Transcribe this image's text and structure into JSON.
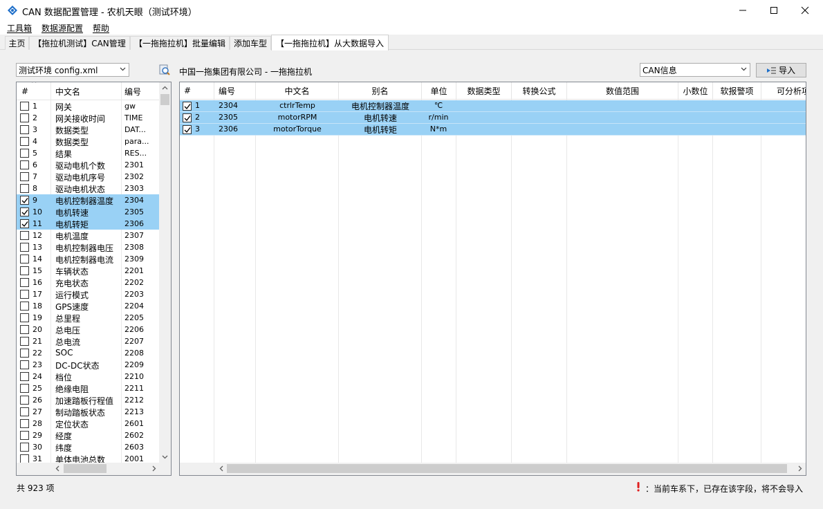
{
  "window": {
    "title": "CAN 数据配置管理 - 农机天眼（测试环境）",
    "minimize_label": "—",
    "maximize_label": "☐",
    "close_label": "✕"
  },
  "menu": [
    "工具箱",
    "数据源配置",
    "帮助"
  ],
  "tabs": [
    {
      "label": "主页",
      "active": false
    },
    {
      "label": "【拖拉机测试】CAN管理",
      "active": false
    },
    {
      "label": "【一拖拖拉机】批量编辑",
      "active": false
    },
    {
      "label": "添加车型",
      "active": false
    },
    {
      "label": "【一拖拖拉机】从大数据导入",
      "active": true
    }
  ],
  "env_select": {
    "value": "测试环境 config.xml"
  },
  "company_label": "中国一拖集团有限公司 - 一拖拖拉机",
  "can_select": {
    "value": "CAN信息"
  },
  "import_button": {
    "label": "导入"
  },
  "left_grid": {
    "headers": [
      "#",
      "中文名",
      "编号"
    ],
    "rows": [
      {
        "num": "1",
        "name": "网关",
        "code": "gw",
        "checked": false
      },
      {
        "num": "2",
        "name": "网关接收时间",
        "code": "TIME",
        "checked": false
      },
      {
        "num": "3",
        "name": "数据类型",
        "code": "DAT...",
        "checked": false
      },
      {
        "num": "4",
        "name": "数据类型",
        "code": "para...",
        "checked": false
      },
      {
        "num": "5",
        "name": "结果",
        "code": "RES...",
        "checked": false
      },
      {
        "num": "6",
        "name": "驱动电机个数",
        "code": "2301",
        "checked": false
      },
      {
        "num": "7",
        "name": "驱动电机序号",
        "code": "2302",
        "checked": false
      },
      {
        "num": "8",
        "name": "驱动电机状态",
        "code": "2303",
        "checked": false
      },
      {
        "num": "9",
        "name": "电机控制器温度",
        "code": "2304",
        "checked": true
      },
      {
        "num": "10",
        "name": "电机转速",
        "code": "2305",
        "checked": true
      },
      {
        "num": "11",
        "name": "电机转矩",
        "code": "2306",
        "checked": true
      },
      {
        "num": "12",
        "name": "电机温度",
        "code": "2307",
        "checked": false
      },
      {
        "num": "13",
        "name": "电机控制器电压",
        "code": "2308",
        "checked": false
      },
      {
        "num": "14",
        "name": "电机控制器电流",
        "code": "2309",
        "checked": false
      },
      {
        "num": "15",
        "name": "车辆状态",
        "code": "2201",
        "checked": false
      },
      {
        "num": "16",
        "name": "充电状态",
        "code": "2202",
        "checked": false
      },
      {
        "num": "17",
        "name": "运行模式",
        "code": "2203",
        "checked": false
      },
      {
        "num": "18",
        "name": "GPS速度",
        "code": "2204",
        "checked": false
      },
      {
        "num": "19",
        "name": "总里程",
        "code": "2205",
        "checked": false
      },
      {
        "num": "20",
        "name": "总电压",
        "code": "2206",
        "checked": false
      },
      {
        "num": "21",
        "name": "总电流",
        "code": "2207",
        "checked": false
      },
      {
        "num": "22",
        "name": "SOC",
        "code": "2208",
        "checked": false
      },
      {
        "num": "23",
        "name": "DC-DC状态",
        "code": "2209",
        "checked": false
      },
      {
        "num": "24",
        "name": "档位",
        "code": "2210",
        "checked": false
      },
      {
        "num": "25",
        "name": "绝缘电阻",
        "code": "2211",
        "checked": false
      },
      {
        "num": "26",
        "name": "加速踏板行程值",
        "code": "2212",
        "checked": false
      },
      {
        "num": "27",
        "name": "制动踏板状态",
        "code": "2213",
        "checked": false
      },
      {
        "num": "28",
        "name": "定位状态",
        "code": "2601",
        "checked": false
      },
      {
        "num": "29",
        "name": "经度",
        "code": "2602",
        "checked": false
      },
      {
        "num": "30",
        "name": "纬度",
        "code": "2603",
        "checked": false
      },
      {
        "num": "31",
        "name": "单体电池总数",
        "code": "2001",
        "checked": false
      }
    ]
  },
  "right_grid": {
    "headers": [
      "#",
      "编号",
      "中文名",
      "别名",
      "单位",
      "数据类型",
      "转换公式",
      "数值范围",
      "小数位",
      "软报警项",
      "可分析项"
    ],
    "rows": [
      {
        "num": "1",
        "code": "2304",
        "name": "ctrlrTemp",
        "alias": "电机控制器温度",
        "unit": "℃",
        "checked": true
      },
      {
        "num": "2",
        "code": "2305",
        "name": "motorRPM",
        "alias": "电机转速",
        "unit": "r/min",
        "checked": true
      },
      {
        "num": "3",
        "code": "2306",
        "name": "motorTorque",
        "alias": "电机转矩",
        "unit": "N*m",
        "checked": true
      }
    ]
  },
  "status": {
    "count_text": "共 923 项",
    "warning_text": "：当前车系下，已存在该字段，将不会导入",
    "warning_icon": "exclamation-icon",
    "warning_color": "#e02020"
  },
  "colors": {
    "selection": "#99d1f5",
    "accent": "#0078d7"
  }
}
